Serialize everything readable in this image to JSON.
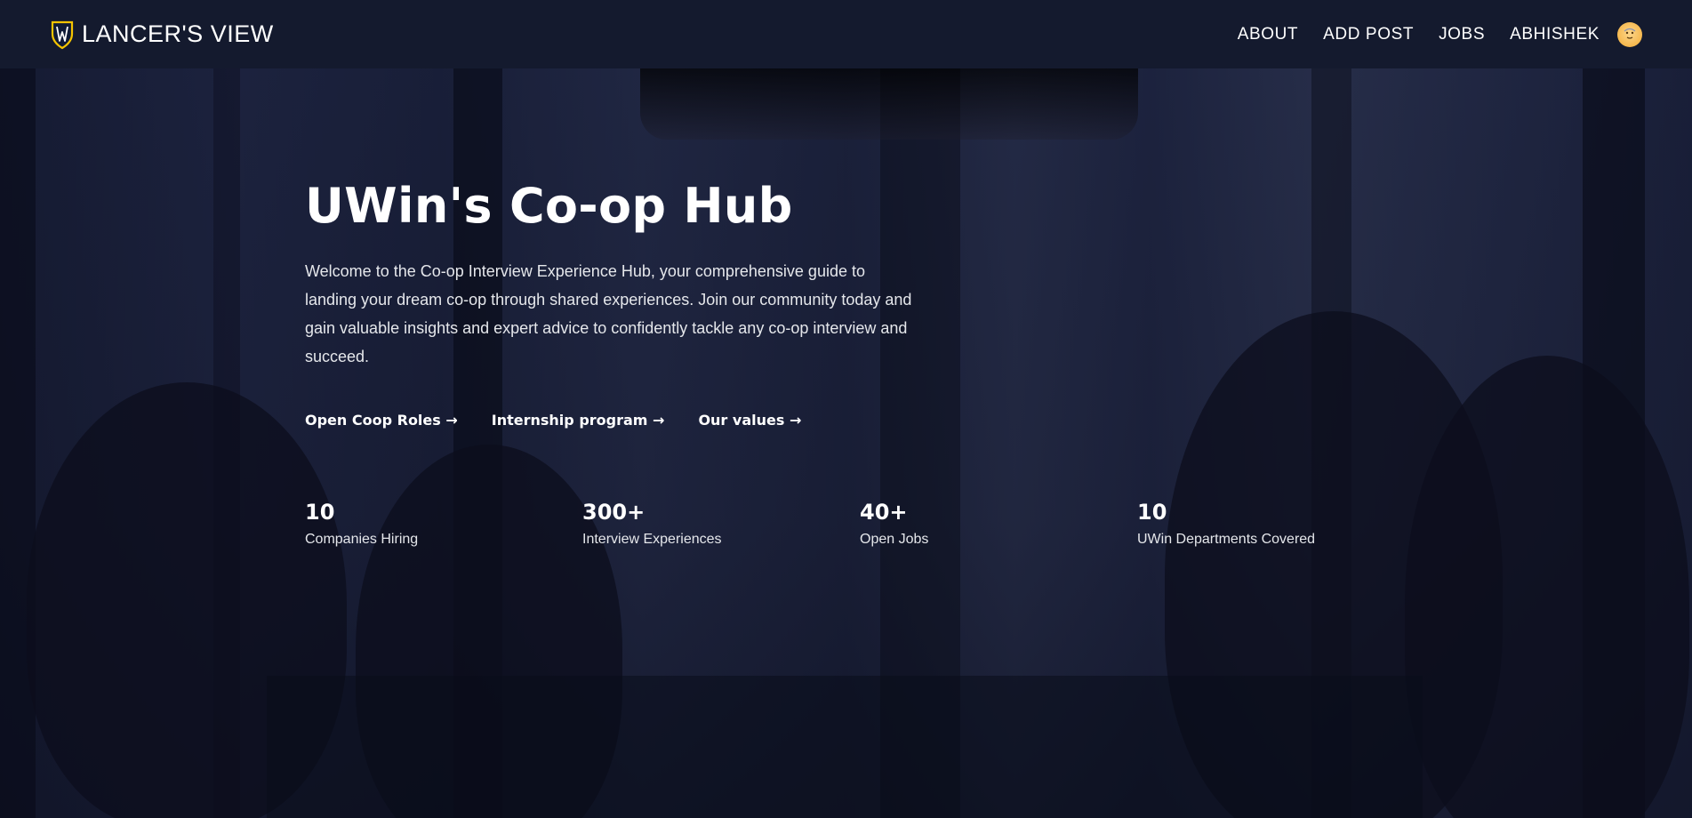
{
  "brand": {
    "name": "LANCER'S VIEW",
    "logo_icon": "shield-logo-icon",
    "colors": {
      "shield_outline": "#f5c400",
      "shield_fill": "#0f1a36"
    }
  },
  "nav": {
    "items": [
      {
        "label": "ABOUT"
      },
      {
        "label": "ADD POST"
      },
      {
        "label": "JOBS"
      },
      {
        "label": "ABHISHEK"
      }
    ],
    "avatar_icon": "user-avatar-icon"
  },
  "hero": {
    "title": "UWin's Co-op Hub",
    "description": "Welcome to the Co-op Interview Experience Hub, your comprehensive guide to landing your dream co-op through shared experiences. Join our community today and gain valuable insights and expert advice to confidently tackle any co-op interview and succeed.",
    "links": [
      {
        "label": "Open Coop Roles →"
      },
      {
        "label": "Internship program →"
      },
      {
        "label": "Our values →"
      }
    ]
  },
  "stats": [
    {
      "value": "10",
      "label": "Companies Hiring"
    },
    {
      "value": "300+",
      "label": "Interview Experiences"
    },
    {
      "value": "40+",
      "label": "Open Jobs"
    },
    {
      "value": "10",
      "label": "UWin Departments Covered"
    }
  ],
  "colors": {
    "header_bg": "#141a2e",
    "overlay": "#181e38",
    "text": "#ffffff",
    "muted_text": "#e5e7eb"
  }
}
